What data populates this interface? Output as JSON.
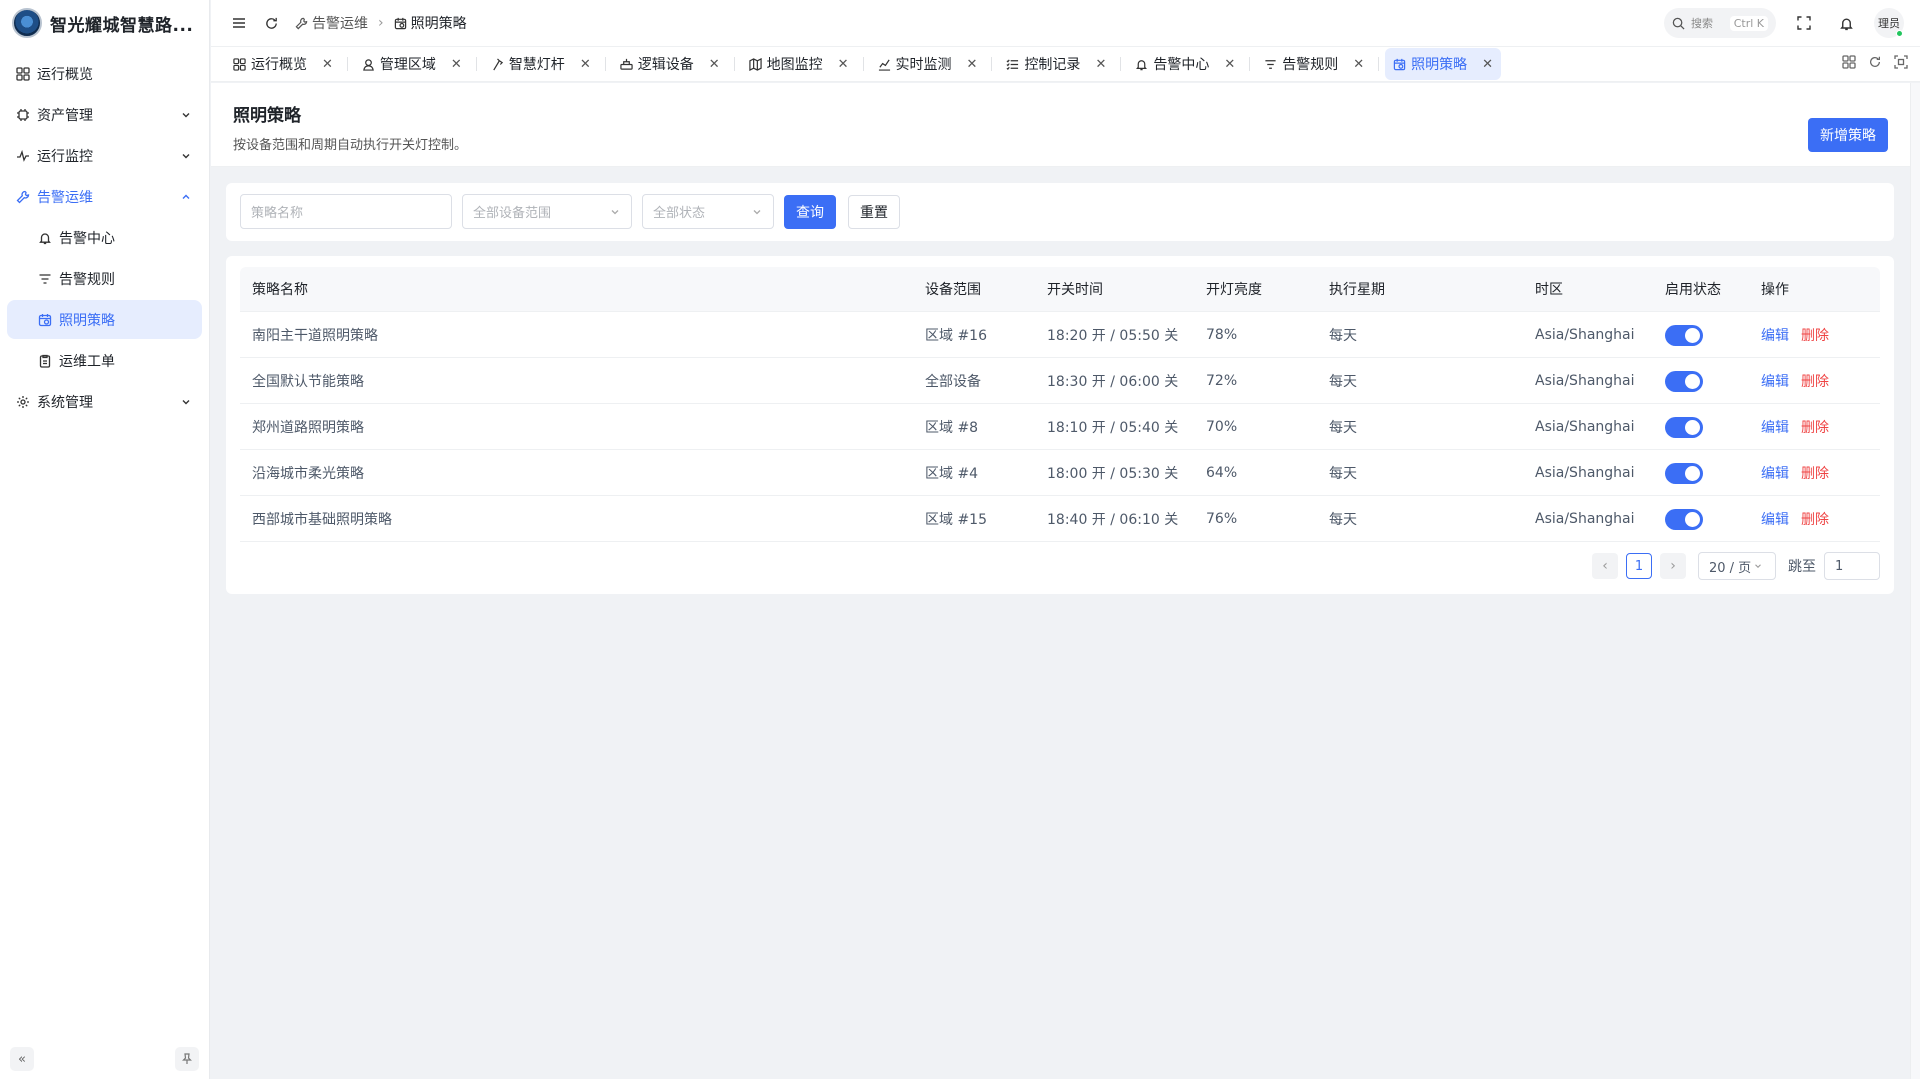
{
  "app": {
    "title": "智光耀城智慧路..."
  },
  "sidebar": {
    "items": [
      {
        "label": "运行概览"
      },
      {
        "label": "资产管理"
      },
      {
        "label": "运行监控"
      },
      {
        "label": "告警运维"
      },
      {
        "label": "告警中心"
      },
      {
        "label": "告警规则"
      },
      {
        "label": "照明策略"
      },
      {
        "label": "运维工单"
      },
      {
        "label": "系统管理"
      }
    ]
  },
  "breadcrumb": {
    "parent": "告警运维",
    "current": "照明策略"
  },
  "header": {
    "search_placeholder": "搜索",
    "search_shortcut": "Ctrl K",
    "user": "理员"
  },
  "tabs": [
    {
      "label": "运行概览"
    },
    {
      "label": "管理区域"
    },
    {
      "label": "智慧灯杆"
    },
    {
      "label": "逻辑设备"
    },
    {
      "label": "地图监控"
    },
    {
      "label": "实时监测"
    },
    {
      "label": "控制记录"
    },
    {
      "label": "告警中心"
    },
    {
      "label": "告警规则"
    },
    {
      "label": "照明策略"
    }
  ],
  "page": {
    "title": "照明策略",
    "description": "按设备范围和周期自动执行开关灯控制。",
    "add_button": "新增策略"
  },
  "filters": {
    "name_placeholder": "策略名称",
    "scope_placeholder": "全部设备范围",
    "status_placeholder": "全部状态",
    "query": "查询",
    "reset": "重置"
  },
  "table": {
    "columns": [
      "策略名称",
      "设备范围",
      "开关时间",
      "开灯亮度",
      "执行星期",
      "时区",
      "启用状态",
      "操作"
    ],
    "rows": [
      {
        "name": "南阳主干道照明策略",
        "scope": "区域 #16",
        "time": "18:20 开 / 05:50 关",
        "brightness": "78%",
        "weekdays": "每天",
        "timezone": "Asia/Shanghai",
        "enabled": true
      },
      {
        "name": "全国默认节能策略",
        "scope": "全部设备",
        "time": "18:30 开 / 06:00 关",
        "brightness": "72%",
        "weekdays": "每天",
        "timezone": "Asia/Shanghai",
        "enabled": true
      },
      {
        "name": "郑州道路照明策略",
        "scope": "区域 #8",
        "time": "18:10 开 / 05:40 关",
        "brightness": "70%",
        "weekdays": "每天",
        "timezone": "Asia/Shanghai",
        "enabled": true
      },
      {
        "name": "沿海城市柔光策略",
        "scope": "区域 #4",
        "time": "18:00 开 / 05:30 关",
        "brightness": "64%",
        "weekdays": "每天",
        "timezone": "Asia/Shanghai",
        "enabled": true
      },
      {
        "name": "西部城市基础照明策略",
        "scope": "区域 #15",
        "time": "18:40 开 / 06:10 关",
        "brightness": "76%",
        "weekdays": "每天",
        "timezone": "Asia/Shanghai",
        "enabled": true
      }
    ],
    "actions": {
      "edit": "编辑",
      "delete": "删除"
    }
  },
  "pagination": {
    "current_page": "1",
    "page_size": "20 / 页",
    "jump_label": "跳至",
    "jump_value": "1"
  },
  "colors": {
    "primary": "#3b6ef5",
    "danger": "#ef4444",
    "active_bg": "#e6edfe"
  }
}
